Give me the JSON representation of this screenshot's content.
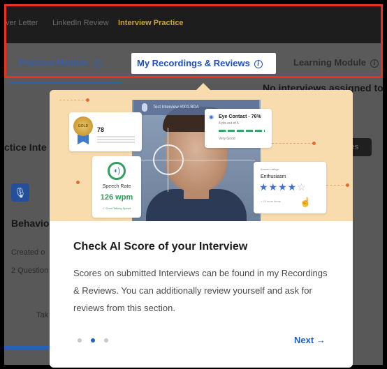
{
  "top_nav": {
    "tabs": [
      {
        "label": "ver Letter"
      },
      {
        "label": "LinkedIn Review"
      },
      {
        "label": "Interview Practice"
      }
    ]
  },
  "module_tabs": {
    "practice": "Practice Module",
    "recordings": "My Recordings & Reviews",
    "learning": "Learning Module",
    "info_glyph": "i"
  },
  "background": {
    "no_interviews": "No interviews assigned to y",
    "section_title": "ctice Inte",
    "pill_label": "ses",
    "card_title": "Behavior",
    "created": "Created o",
    "questions": "2 Question",
    "take": "Tak"
  },
  "popup": {
    "hero": {
      "recording_label": "Test Interview #001.BDA",
      "score_medal": "GOLD",
      "score_value": "78",
      "eye_contact_title": "Eye Contact - 76%",
      "eye_contact_sub": "4 pts  out of 5",
      "eye_contact_foot": "Very Good",
      "speech_label": "Speech Rate",
      "speech_value": "126 wpm",
      "speech_good": "✓ Good Talking Speed",
      "enth_head": "Answer ratings",
      "enth_title": "Enthusiasm",
      "enth_stars": "★★★★",
      "enth_empty_star": "☆",
      "enth_foot": "+ 15 more items"
    },
    "title": "Check AI Score of your Interview",
    "description": "Scores on submitted Interviews can be found in my Recordings & Reviews. You can additionally review yourself and ask for reviews from this section.",
    "pagination": {
      "count": 3,
      "active_index": 1
    },
    "next_label": "Next →"
  },
  "colors": {
    "accent_blue": "#1f5fc2",
    "highlight_red": "#e8321f",
    "active_nav_gold": "#c9a23a",
    "hero_bg": "#f8dcae"
  }
}
